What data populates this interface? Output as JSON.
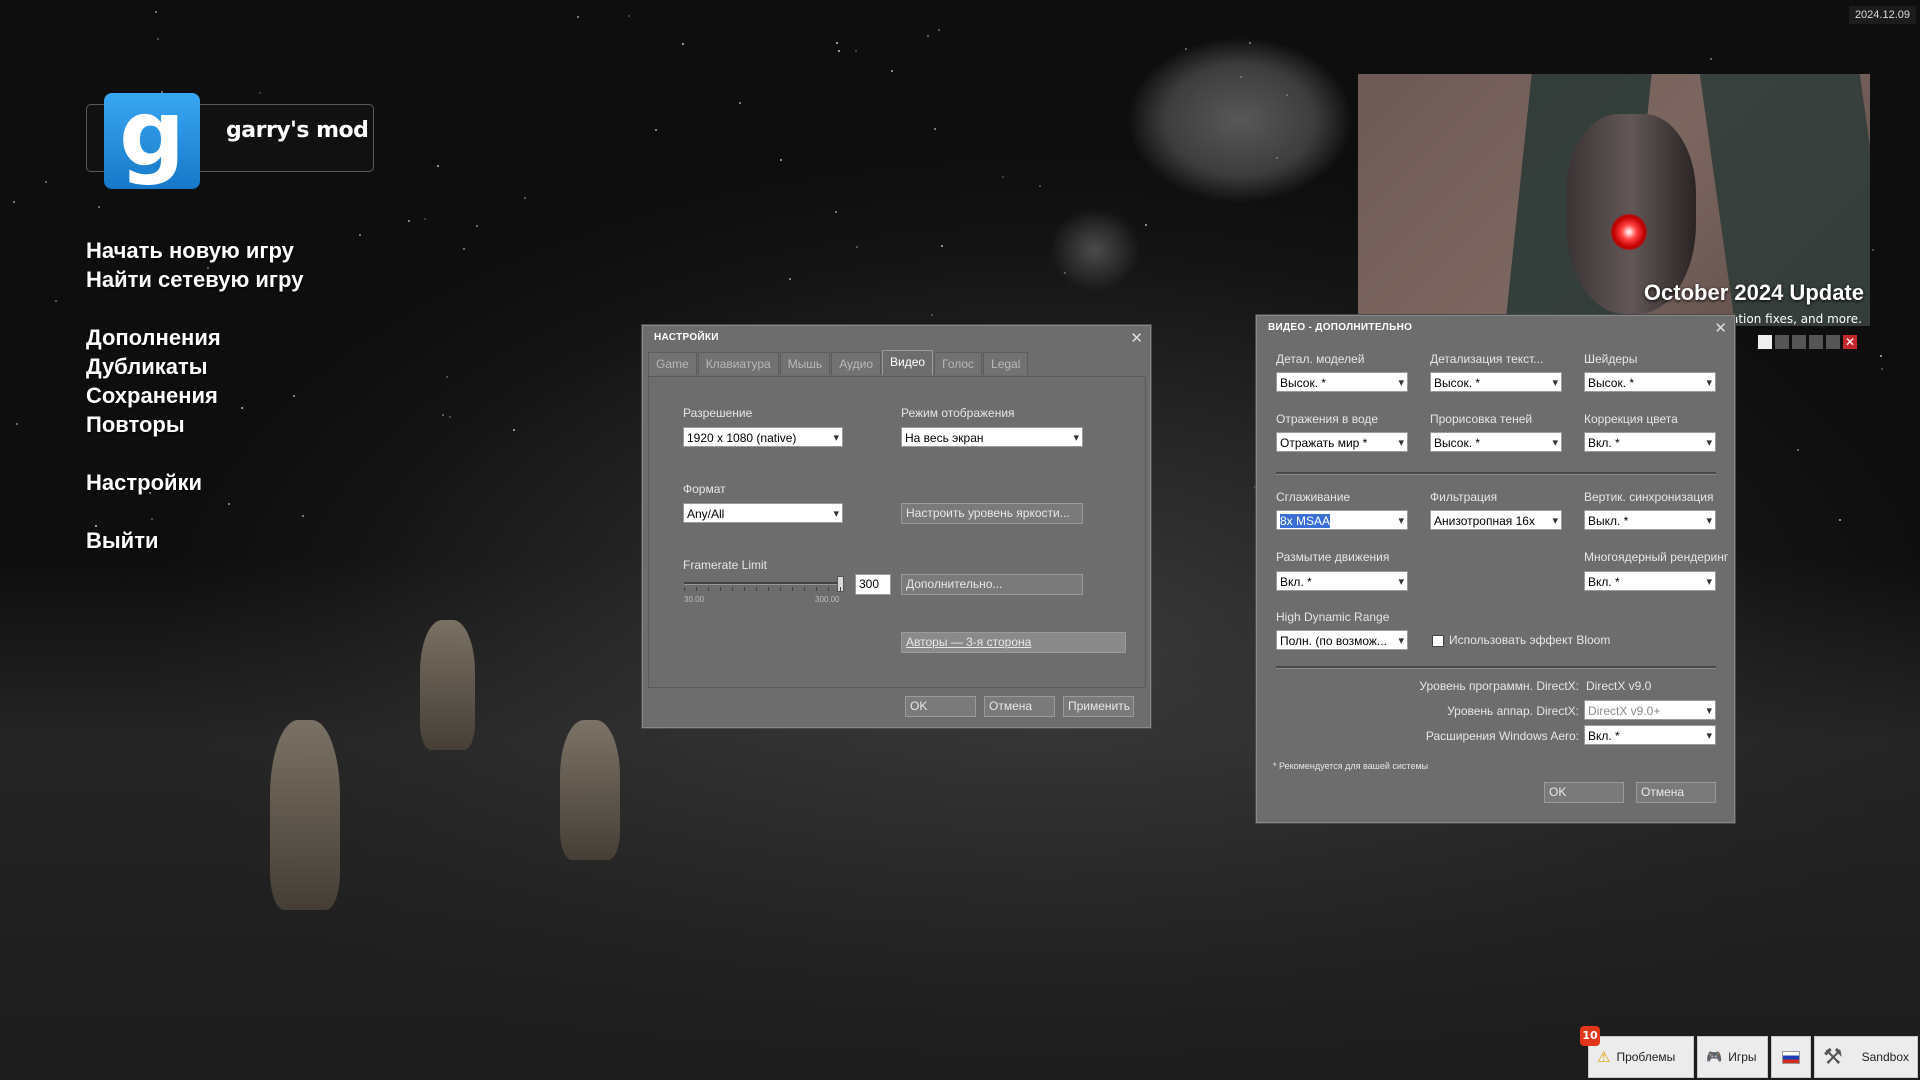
{
  "date": "2024.12.09",
  "logo": {
    "letter": "g",
    "name": "garry's mod"
  },
  "main_menu": [
    "Начать новую игру",
    "Найти сетевую игру",
    "Дополнения",
    "Дубликаты",
    "Сохранения",
    "Повторы",
    "Настройки",
    "Выйти"
  ],
  "news": {
    "title": "October 2024 Update",
    "subtitle": "nation fixes, and more.",
    "close": "✕"
  },
  "settings": {
    "title": "НАСТРОЙКИ",
    "close": "✕",
    "tabs": [
      "Game",
      "Клавиатура",
      "Мышь",
      "Аудио",
      "Видео",
      "Голос",
      "Legal"
    ],
    "active_tab": "Видео",
    "resolution_label": "Разрешение",
    "resolution_value": "1920 x 1080 (native)",
    "display_mode_label": "Режим отображения",
    "display_mode_value": "На весь экран",
    "format_label": "Формат",
    "format_value": "Any/All",
    "brightness_button": "Настроить уровень яркости...",
    "framerate_label": "Framerate Limit",
    "framerate_min": "30.00",
    "framerate_max": "300.00",
    "framerate_value": "300",
    "advanced_button": "Дополнительно...",
    "credits_button": "Авторы — 3-я сторона",
    "ok": "OK",
    "cancel": "Отмена",
    "apply": "Применить"
  },
  "video_advanced": {
    "title": "ВИДЕО - ДОПОЛНИТЕЛЬНО",
    "close": "✕",
    "model_detail_label": "Детал. моделей",
    "model_detail_value": "Высок. *",
    "texture_detail_label": "Детализация текст...",
    "texture_detail_value": "Высок. *",
    "shaders_label": "Шейдеры",
    "shaders_value": "Высок. *",
    "water_label": "Отражения в воде",
    "water_value": "Отражать мир *",
    "shadows_label": "Прорисовка теней",
    "shadows_value": "Высок. *",
    "color_label": "Коррекция цвета",
    "color_value": "Вкл. *",
    "aa_label": "Сглаживание",
    "aa_value": "8x MSAA",
    "filter_label": "Фильтрация",
    "filter_value": "Анизотропная 16x",
    "vsync_label": "Вертик. синхронизация",
    "vsync_value": "Выкл. *",
    "motion_blur_label": "Размытие движения",
    "motion_blur_value": "Вкл. *",
    "multicore_label": "Многоядерный рендеринг",
    "multicore_value": "Вкл. *",
    "hdr_label": "High Dynamic Range",
    "hdr_value": "Полн. (по возмож...",
    "bloom_label": "Использовать эффект Bloom",
    "dx_sw_label": "Уровень программн. DirectX:",
    "dx_sw_value": "DirectX v9.0",
    "dx_hw_label": "Уровень аппар. DirectX:",
    "dx_hw_value": "DirectX v9.0+",
    "aero_label": "Расширения Windows Aero:",
    "aero_value": "Вкл. *",
    "footnote": "* Рекомендуется для вашей системы",
    "ok": "OK",
    "cancel": "Отмена"
  },
  "bottom_bar": {
    "problems_count": "10",
    "problems": "Проблемы",
    "games": "Игры",
    "gamemode": "Sandbox"
  }
}
